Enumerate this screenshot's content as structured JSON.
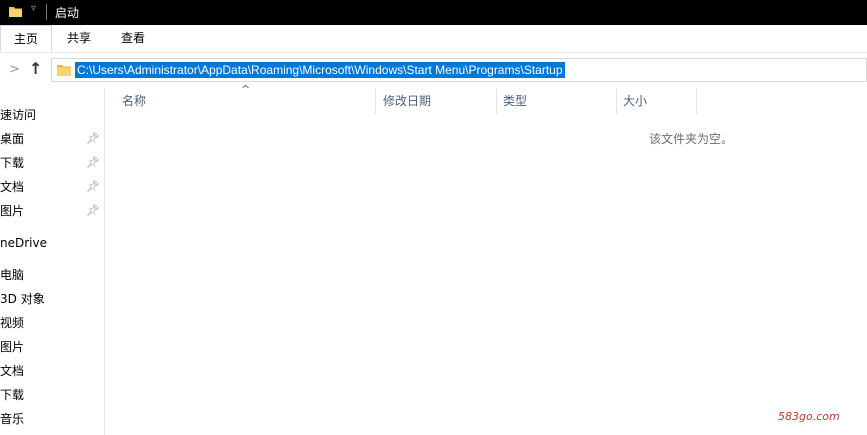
{
  "window": {
    "title": "启动"
  },
  "ribbon": {
    "tabs": [
      "主页",
      "共享",
      "查看"
    ]
  },
  "address_bar": {
    "path": "C:\\Users\\Administrator\\AppData\\Roaming\\Microsoft\\Windows\\Start Menu\\Programs\\Startup"
  },
  "nav_pane": {
    "items": [
      {
        "label": "速访问",
        "pinned": false
      },
      {
        "label": "桌面",
        "pinned": true
      },
      {
        "label": "下载",
        "pinned": true
      },
      {
        "label": "文档",
        "pinned": true
      },
      {
        "label": "图片",
        "pinned": true
      },
      {
        "label": "neDrive",
        "pinned": false
      },
      {
        "label": "电脑",
        "pinned": false
      },
      {
        "label": "3D 对象",
        "pinned": false
      },
      {
        "label": "视频",
        "pinned": false
      },
      {
        "label": "图片",
        "pinned": false
      },
      {
        "label": "文档",
        "pinned": false
      },
      {
        "label": "下载",
        "pinned": false
      },
      {
        "label": "音乐",
        "pinned": false
      }
    ]
  },
  "columns": {
    "name": "名称",
    "date_modified": "修改日期",
    "type": "类型",
    "size": "大小"
  },
  "content": {
    "empty_message": "该文件夹为空。"
  },
  "watermark": "583go.com",
  "colors": {
    "selection": "#0078d7",
    "folder": "#f0c24a",
    "titlebar": "#000000"
  }
}
